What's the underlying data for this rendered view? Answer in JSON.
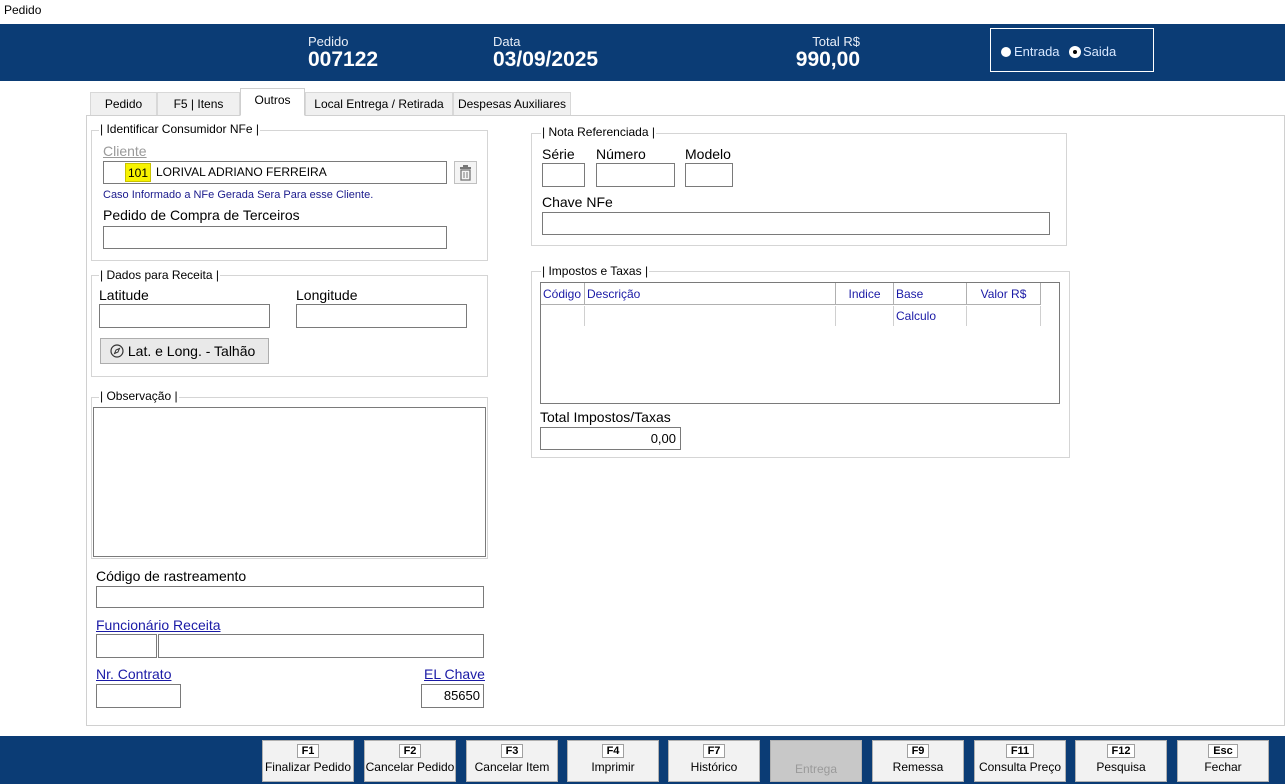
{
  "window": {
    "title": "Pedido"
  },
  "header": {
    "pedido_label": "Pedido",
    "pedido_value": "007122",
    "data_label": "Data",
    "data_value": "03/09/2025",
    "total_label": "Total R$",
    "total_value": "990,00",
    "radio_entrada": "Entrada",
    "radio_saida": "Saida",
    "radio_selected": "Saida"
  },
  "tabs": [
    "Pedido",
    "F5 | Itens",
    "Outros",
    "Local Entrega  / Retirada",
    "Despesas Auxiliares"
  ],
  "active_tab": "Outros",
  "consumidor": {
    "group_title": "| Identificar Consumidor NFe |",
    "cliente_label": "Cliente",
    "cliente_code": "101",
    "cliente_name": "LORIVAL ADRIANO FERREIRA",
    "hint": "Caso Informado a NFe Gerada Sera Para esse Cliente.",
    "pedido_compra_label": "Pedido de Compra de Terceiros",
    "pedido_compra_value": ""
  },
  "receita": {
    "group_title": "| Dados para Receita |",
    "latitude_label": "Latitude",
    "latitude_value": "",
    "longitude_label": "Longitude",
    "longitude_value": "",
    "button_label": "Lat. e Long. - Talhão"
  },
  "observacao": {
    "group_title": "| Observação |",
    "value": ""
  },
  "rastreamento": {
    "label": "Código de rastreamento",
    "value": ""
  },
  "funcionario": {
    "label": "Funcionário Receita",
    "code": "",
    "name": ""
  },
  "contrato": {
    "label": "Nr. Contrato",
    "value": ""
  },
  "el_chave": {
    "label": "EL Chave",
    "value": "85650"
  },
  "nota_ref": {
    "group_title": "| Nota Referenciada |",
    "serie_label": "Série",
    "numero_label": "Número",
    "modelo_label": "Modelo",
    "chave_label": "Chave NFe"
  },
  "impostos": {
    "group_title": "| Impostos e Taxas |",
    "columns": [
      "Código",
      "Descrição",
      "Indice",
      "Base Calculo",
      "Valor R$"
    ],
    "total_label": "Total Impostos/Taxas",
    "total_value": "0,00"
  },
  "footer": {
    "buttons": [
      {
        "key": "F1",
        "label": "Finalizar Pedido"
      },
      {
        "key": "F2",
        "label": "Cancelar Pedido"
      },
      {
        "key": "F3",
        "label": "Cancelar Item"
      },
      {
        "key": "F4",
        "label": "Imprimir"
      },
      {
        "key": "F7",
        "label": "Histórico"
      },
      {
        "key": "",
        "label": "Entrega"
      },
      {
        "key": "F9",
        "label": "Remessa"
      },
      {
        "key": "F11",
        "label": "Consulta Preço"
      },
      {
        "key": "F12",
        "label": "Pesquisa"
      },
      {
        "key": "Esc",
        "label": "Fechar"
      }
    ]
  }
}
